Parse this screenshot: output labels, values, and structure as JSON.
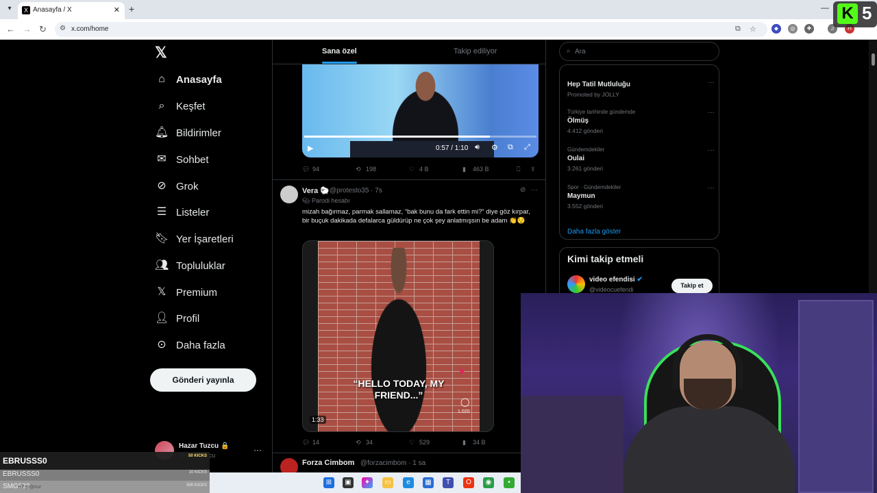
{
  "browser": {
    "tab_title": "Anasayfa / X",
    "tab_favicon": "X",
    "tab_close": "✕",
    "new_tab": "+",
    "url": "x.com/home",
    "minimize": "—"
  },
  "overlay_logo": {
    "letter": "K",
    "number": "5"
  },
  "x_nav": {
    "logo": "𝕏",
    "items": [
      {
        "label": "Anasayfa",
        "icon": "home-icon"
      },
      {
        "label": "Keşfet",
        "icon": "search-icon"
      },
      {
        "label": "Bildirimler",
        "icon": "bell-icon"
      },
      {
        "label": "Sohbet",
        "icon": "mail-icon"
      },
      {
        "label": "Grok",
        "icon": "grok-icon"
      },
      {
        "label": "Listeler",
        "icon": "list-icon"
      },
      {
        "label": "Yer İşaretleri",
        "icon": "bookmark-icon"
      },
      {
        "label": "Topluluklar",
        "icon": "people-icon"
      },
      {
        "label": "Premium",
        "icon": "x-icon"
      },
      {
        "label": "Profil",
        "icon": "person-icon"
      },
      {
        "label": "Daha fazla",
        "icon": "more-circle-icon"
      }
    ],
    "post_button": "Gönderi yayınla"
  },
  "account": {
    "name": "Hazar Tuzcu 🔒",
    "handle": "@hazartuzcu",
    "more": "···"
  },
  "timeline": {
    "tabs": [
      "Sana özel",
      "Takip ediliyor"
    ],
    "video1": {
      "time": "0:57 / 1:10",
      "progress": 0.8
    },
    "tweet1_actions": {
      "replies": "94",
      "reposts": "198",
      "likes": "4 B",
      "views": "463 B"
    },
    "tweet2": {
      "name": "Vera 🐑",
      "handle": "@protesto35 · 7s",
      "sub": "Parodi hesabı",
      "text": "mizah bağırmaz, parmak sallamaz, “bak bunu da fark ettin mi?” diye göz kırpar, bir buçuk dakikada defalarca güldürüp ne çok şey anlatmışsın be adam 👏😌",
      "video_caption": "“HELLO TODAY, MY FRIEND...”",
      "video_duration": "1:33",
      "video_comments": "1.020",
      "actions": {
        "replies": "14",
        "reposts": "34",
        "likes": "529",
        "views": "34 B"
      }
    },
    "tweet3": {
      "name": "Forza Cimbom",
      "handle": "@forzacimbom · 1 sa"
    }
  },
  "right": {
    "search_placeholder": "Ara",
    "trends": [
      {
        "category": "",
        "name": "Hep Tatil Mutluluğu",
        "count": "Promoted by JOLLY"
      },
      {
        "category": "Türkiye tarihinde gündemde",
        "name": "Ölmüş",
        "count": "4.412 gönderi"
      },
      {
        "category": "Gündemdekiler",
        "name": "Oulai",
        "count": "3.261 gönderi"
      },
      {
        "category": "Spor · Gündemdekiler",
        "name": "Maymun",
        "count": "3.552 gönderi"
      }
    ],
    "show_more": "Daha fazla göster",
    "who_to_follow": {
      "title": "Kimi takip etmeli",
      "name": "video efendisi",
      "handle": "@videocuefendi",
      "button": "Takip et"
    }
  },
  "kicks_overlay": [
    {
      "name": "EBRUSSS0",
      "kicks": "50 KICKS"
    },
    {
      "name": "EBRUSSS0",
      "kicks": "10 KICKS"
    },
    {
      "name": "SMG523",
      "sub": "elif yağmur",
      "kicks": "500 KICKS"
    }
  ]
}
